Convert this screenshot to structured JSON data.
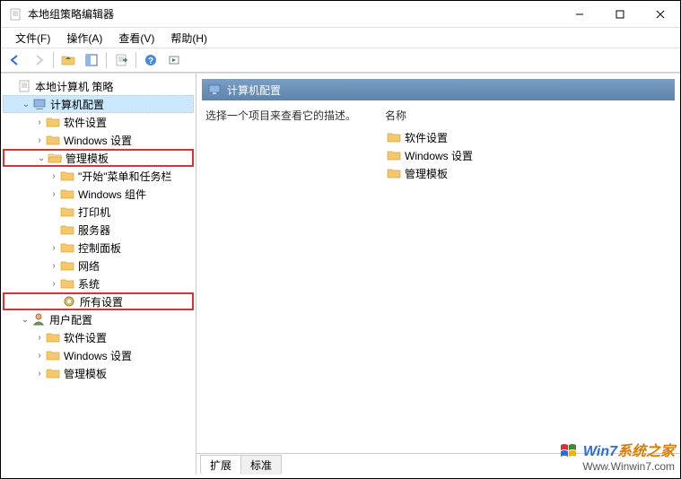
{
  "titlebar": {
    "title": "本地组策略编辑器"
  },
  "menubar": {
    "file": "文件(F)",
    "action": "操作(A)",
    "view": "查看(V)",
    "help": "帮助(H)"
  },
  "tree": {
    "root": "本地计算机 策略",
    "computer": "计算机配置",
    "c_soft": "软件设置",
    "c_win": "Windows 设置",
    "c_tmpl": "管理模板",
    "t_start": "\"开始\"菜单和任务栏",
    "t_wincom": "Windows 组件",
    "t_printer": "打印机",
    "t_server": "服务器",
    "t_cpanel": "控制面板",
    "t_net": "网络",
    "t_sys": "系统",
    "t_all": "所有设置",
    "user": "用户配置",
    "u_soft": "软件设置",
    "u_win": "Windows 设置",
    "u_tmpl": "管理模板"
  },
  "right": {
    "header": "计算机配置",
    "prompt": "选择一个项目来查看它的描述。",
    "colname": "名称",
    "items": {
      "soft": "软件设置",
      "win": "Windows 设置",
      "tmpl": "管理模板"
    }
  },
  "tabs": {
    "extended": "扩展",
    "standard": "标准"
  },
  "watermark": {
    "brand1": "Win7",
    "brand2": "系统之家",
    "url": "Www.Winwin7.com"
  },
  "colors": {
    "folder": "#f5c96b",
    "folder_dark": "#d9a441",
    "blue": "#2a6edb",
    "red": "#e03030"
  }
}
